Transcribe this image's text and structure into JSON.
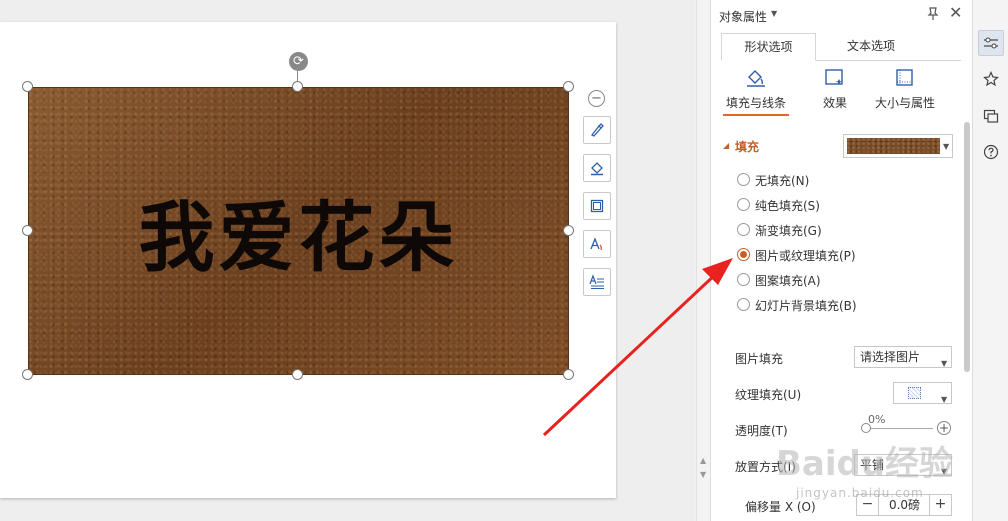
{
  "canvas": {
    "shape_text": "我爱花朵"
  },
  "panel": {
    "title": "对象属性",
    "tabs": [
      {
        "label": "形状选项",
        "active": true
      },
      {
        "label": "文本选项",
        "active": false
      }
    ],
    "subtabs": [
      {
        "label": "填充与线条",
        "icon": "paint-bucket-icon",
        "active": true
      },
      {
        "label": "效果",
        "icon": "effect-icon",
        "active": false
      },
      {
        "label": "大小与属性",
        "icon": "size-icon",
        "active": false
      }
    ],
    "fill": {
      "title": "填充",
      "options": [
        {
          "label": "无填充(N)",
          "checked": false
        },
        {
          "label": "纯色填充(S)",
          "checked": false
        },
        {
          "label": "渐变填充(G)",
          "checked": false
        },
        {
          "label": "图片或纹理填充(P)",
          "checked": true
        },
        {
          "label": "图案填充(A)",
          "checked": false
        },
        {
          "label": "幻灯片背景填充(B)",
          "checked": false
        }
      ],
      "picture_fill_label": "图片填充",
      "picture_fill_value": "请选择图片",
      "texture_fill_label": "纹理填充(U)",
      "opacity_label": "透明度(T)",
      "opacity_value": "0%",
      "tile_label": "放置方式(I)",
      "tile_value": "平铺",
      "offset_x_label": "偏移量 X (O)",
      "offset_x_value": "0.0磅"
    }
  },
  "watermark": {
    "brand": "Baidu经验",
    "url": "jingyan.baidu.com"
  },
  "colors": {
    "accent": "#c0632b",
    "arrow": "#e8231f",
    "leather": "#7a4b26"
  }
}
